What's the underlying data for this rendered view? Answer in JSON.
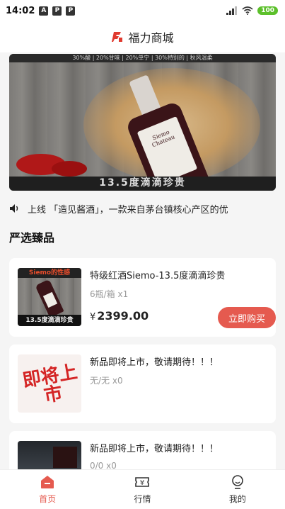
{
  "status_bar": {
    "time": "14:02",
    "notifications": [
      "A",
      "P",
      "P"
    ],
    "battery": "100"
  },
  "header": {
    "title": "福力商城",
    "logo_icon": "fuli-logo-icon"
  },
  "banner": {
    "top_text": "30%酸 | 20%甘味 | 20%单宁 | 30%特别的 | 秋风温柔",
    "caption": "13.5度滴滴珍贵",
    "label_text": "Siemo Chateau"
  },
  "notice": {
    "icon": "speaker-icon",
    "text": "上线 「造见酱酒」，一款来自茅台镇核心产区的优"
  },
  "section": {
    "title": "严选臻品"
  },
  "products": [
    {
      "name": "特级红酒Siemo-13.5度滴滴珍贵",
      "spec": "6瓶/箱 x1",
      "currency": "¥",
      "price": "2399.00",
      "buy_label": "立即购买",
      "image_top": "Siemo的性感",
      "image_bottom": "13.5度滴滴珍贵"
    },
    {
      "name": "新品即将上市，敬请期待！！！",
      "spec": "无/无 x0",
      "image_text": "即将上市"
    },
    {
      "name": "新品即将上市，敬请期待！！！",
      "spec": "0/0 x0"
    }
  ],
  "tabbar": {
    "items": [
      {
        "label": "首页",
        "icon": "home-icon",
        "active": true
      },
      {
        "label": "行情",
        "icon": "ticket-yen-icon",
        "active": false
      },
      {
        "label": "我的",
        "icon": "user-icon",
        "active": false
      }
    ]
  },
  "colors": {
    "accent": "#e55a4f",
    "background": "#f5f5f5",
    "card": "#ffffff"
  }
}
